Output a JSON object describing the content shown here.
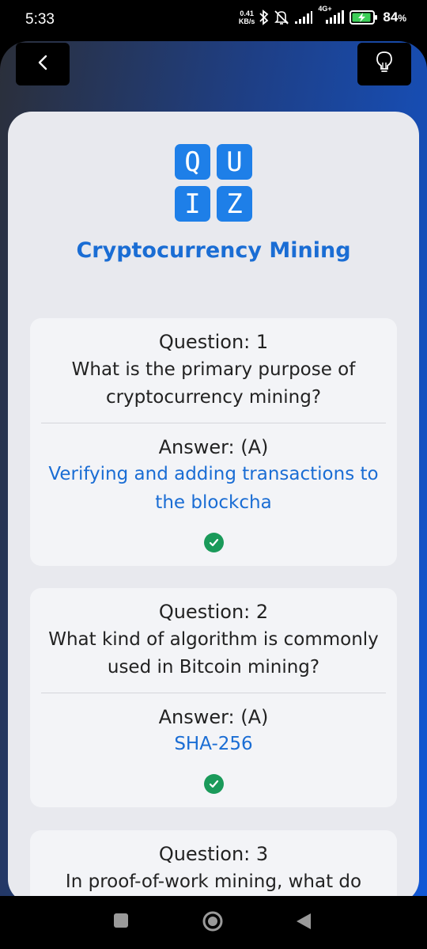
{
  "status_bar": {
    "time": "5:33",
    "net_speed_value": "0.41",
    "net_speed_unit": "KB/s",
    "network_type": "4G+",
    "battery_percent": "84",
    "battery_suffix": "%",
    "icons": [
      "bluetooth-icon",
      "mute-bell-icon",
      "signal-icon",
      "signal-4g-icon",
      "battery-charging-icon"
    ]
  },
  "header": {
    "back_icon": "chevron-left-icon",
    "hint_icon": "lightbulb-icon",
    "background_colors": [
      "#2b2f3a",
      "#1158d6"
    ]
  },
  "logo": {
    "letters": [
      "Q",
      "U",
      "I",
      "Z"
    ],
    "color": "#1e7fe8"
  },
  "quiz": {
    "title": "Cryptocurrency Mining",
    "accent_color": "#1a6dd4",
    "correct_color": "#1a9a5a",
    "questions": [
      {
        "heading": "Question: 1",
        "text": "What is the primary purpose of cryptocurrency mining?",
        "answer_heading": "Answer: (A)",
        "answer_text": "Verifying and adding transactions to the blockcha",
        "status_icon": "check-circle-icon"
      },
      {
        "heading": "Question: 2",
        "text": "What kind of algorithm is commonly used in Bitcoin mining?",
        "answer_heading": "Answer: (A)",
        "answer_text": "SHA-256",
        "status_icon": "check-circle-icon"
      },
      {
        "heading": "Question: 3",
        "text": "In proof-of-work mining, what do miners compete to solve?"
      }
    ]
  },
  "nav_bar": {
    "icons": [
      "recents-square-icon",
      "home-circle-icon",
      "back-triangle-icon"
    ]
  }
}
